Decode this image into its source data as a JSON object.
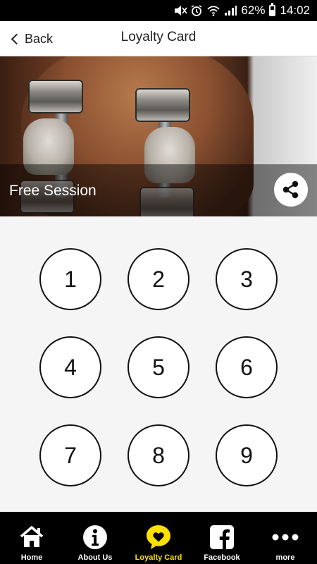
{
  "status_bar": {
    "battery": "62%",
    "time": "14:02"
  },
  "header": {
    "back_label": "Back",
    "title": "Loyalty Card"
  },
  "hero": {
    "caption": "Free Session"
  },
  "stamps": [
    "1",
    "2",
    "3",
    "4",
    "5",
    "6",
    "7",
    "8",
    "9"
  ],
  "nav": {
    "items": [
      {
        "label": "Home",
        "icon": "home-icon"
      },
      {
        "label": "About Us",
        "icon": "info-icon"
      },
      {
        "label": "Loyalty Card",
        "icon": "heart-icon"
      },
      {
        "label": "Facebook",
        "icon": "facebook-icon"
      },
      {
        "label": "more",
        "icon": "more-icon"
      }
    ],
    "active_index": 2
  },
  "colors": {
    "accent": "#ffe000",
    "nav_bg": "#000000",
    "stamp_border": "#111111"
  }
}
